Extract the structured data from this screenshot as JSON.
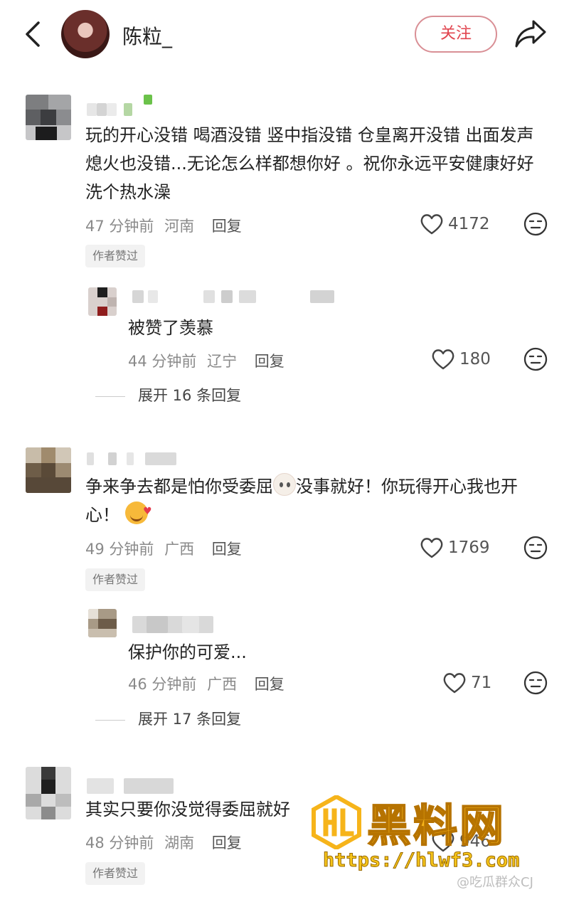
{
  "header": {
    "title": "陈粒_",
    "follow_label": "关注",
    "back_icon": "back-icon",
    "share_icon": "share-icon"
  },
  "comments": [
    {
      "text": "玩的开心没错 喝酒没错 竖中指没错 仓皇离开没错 出面发声熄火也没错...无论怎么样都想你好 。祝你永远平安健康好好洗个热水澡",
      "time": "47 分钟前",
      "location": "河南",
      "reply_label": "回复",
      "likes": "4172",
      "badge": "作者赞过",
      "sub_reply": {
        "text": "被赞了羡慕",
        "time": "44 分钟前",
        "location": "辽宁",
        "reply_label": "回复",
        "likes": "180"
      },
      "expand_label": "展开 16 条回复"
    },
    {
      "text_part1": "争来争去都是怕你受委屈",
      "text_part2": "没事就好！你玩得开心我也开心！",
      "time": "49 分钟前",
      "location": "广西",
      "reply_label": "回复",
      "likes": "1769",
      "badge": "作者赞过",
      "sub_reply": {
        "text": "保护你的可爱...",
        "time": "46 分钟前",
        "location": "广西",
        "reply_label": "回复",
        "likes": "71"
      },
      "expand_label": "展开 17 条回复"
    },
    {
      "text": "其实只要你没觉得委屈就好",
      "time": "48 分钟前",
      "location": "湖南",
      "reply_label": "回复",
      "likes": "946",
      "badge": "作者赞过"
    }
  ],
  "watermark": {
    "title": "黑料网",
    "url": "https://hlwf3.com",
    "weibo": "@吃瓜群众CJ"
  },
  "colors": {
    "accent": "#e1454f",
    "follow_border": "#d98f95",
    "watermark": "#f6b41a"
  }
}
